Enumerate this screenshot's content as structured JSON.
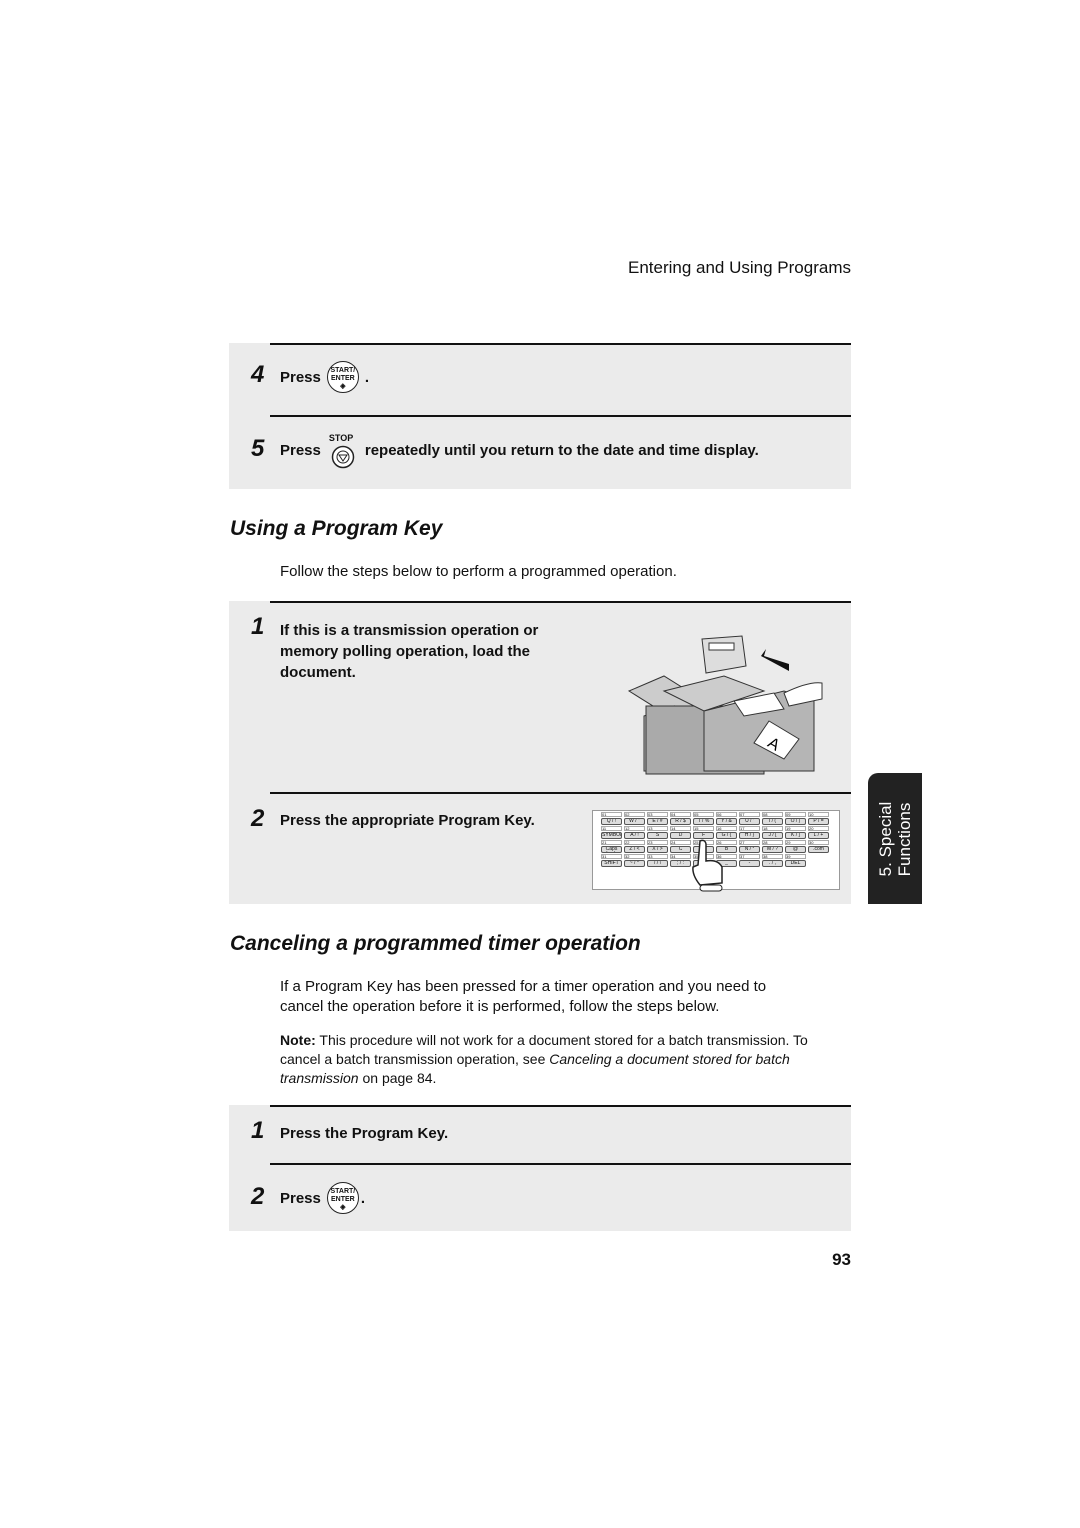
{
  "running_header": "Entering and Using Programs",
  "block1": {
    "step4": {
      "num": "4",
      "press": "Press",
      "key_top": "START/",
      "key_bottom": "ENTER",
      "after": "."
    },
    "step5": {
      "num": "5",
      "press": "Press",
      "key_label": "STOP",
      "after": "repeatedly until you return to the date and time display."
    }
  },
  "section1": {
    "title": "Using a Program Key",
    "intro": "Follow the steps below to perform a programmed operation."
  },
  "block2": {
    "step1": {
      "num": "1",
      "lines": [
        "If this is a transmission operation or",
        "memory polling operation, load the",
        "document."
      ]
    },
    "step2": {
      "num": "2",
      "text": "Press the appropriate Program Key."
    }
  },
  "keyboard": {
    "rows": [
      {
        "nums": [
          "01",
          "02",
          "03",
          "04",
          "05",
          "06",
          "07",
          "08",
          "09",
          "10"
        ],
        "keys": [
          "Q / !",
          "W / \"",
          "E / #",
          "R / $",
          "T / %",
          "Y / &",
          "U / '",
          "I / (",
          "O / )",
          "P / ="
        ]
      },
      {
        "nums": [
          "11",
          "12",
          "13",
          "14",
          "15",
          "16",
          "17",
          "18",
          "19",
          "20"
        ],
        "keys": [
          "SYMBOL",
          "A / !",
          "S",
          "D",
          "F",
          "G / {",
          "H / }",
          "J / [",
          "K / ]",
          "L / +"
        ]
      },
      {
        "nums": [
          "21",
          "22",
          "23",
          "24",
          "25",
          "26",
          "27",
          "28",
          "29",
          "30"
        ],
        "keys": [
          "Caps Lock",
          "Z / <",
          "X / >",
          "C",
          "V",
          "B",
          "N / *",
          "M / ?",
          "@",
          ".com"
        ]
      },
      {
        "nums": [
          "31",
          "32",
          "33",
          "34",
          "35",
          "36",
          "37",
          "38",
          "39"
        ],
        "keys": [
          "SHIFT",
          "~ / ^",
          "/ / \\",
          "; / :",
          "",
          "_",
          "-",
          ". / ,",
          "DEL"
        ]
      }
    ]
  },
  "side_tab": {
    "line1": "5. Special",
    "line2": "Functions"
  },
  "section2": {
    "title": "Canceling a programmed timer operation",
    "intro": [
      "If a Program Key has been pressed for a timer operation and you need to",
      "cancel the operation before it is performed, follow the steps below."
    ],
    "note_label": "Note:",
    "note_text1": " This procedure will not work for a document stored for a batch transmission. To cancel a batch transmission operation, see ",
    "note_link": "Canceling a document stored for batch transmission",
    "note_text2": " on page 84."
  },
  "block3": {
    "step1": {
      "num": "1",
      "text": "Press the Program Key."
    },
    "step2": {
      "num": "2",
      "press": "Press",
      "key_top": "START/",
      "key_bottom": "ENTER",
      "after": "."
    }
  },
  "page_number": "93"
}
